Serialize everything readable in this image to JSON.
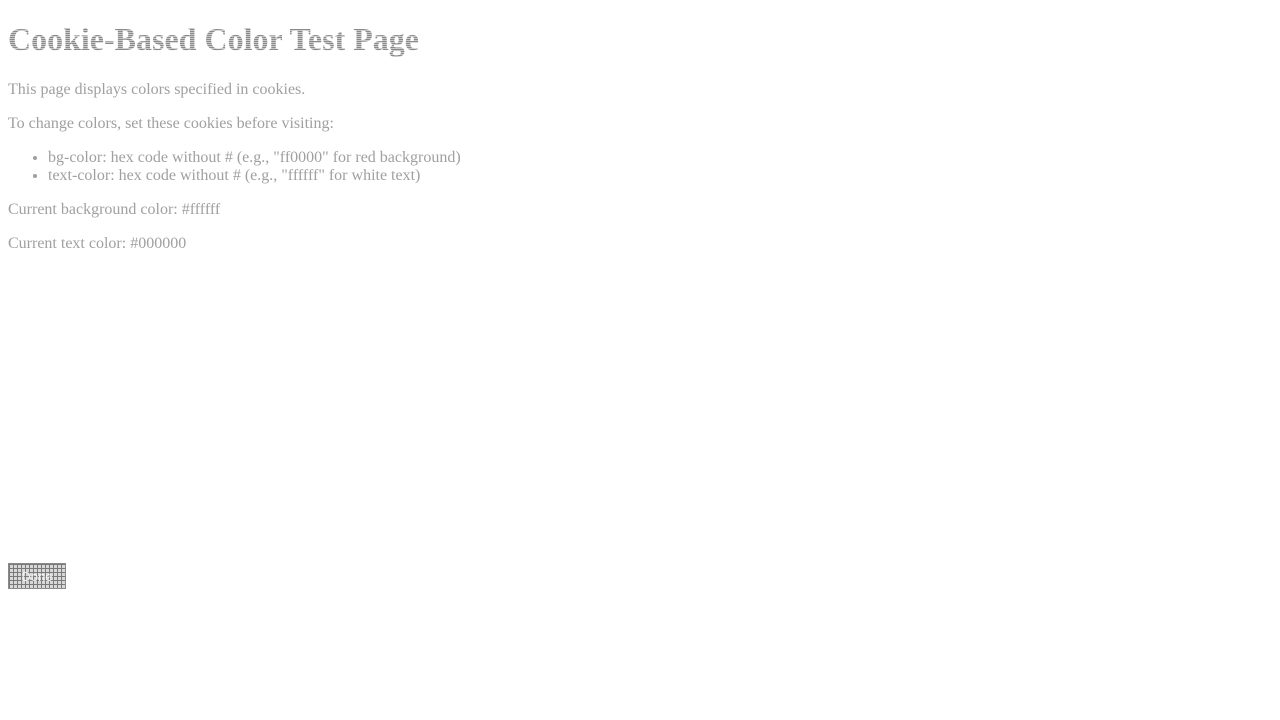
{
  "page": {
    "title": "Cookie-Based Color Test Page",
    "intro": "This page displays colors specified in cookies.",
    "instructions": "To change colors, set these cookies before visiting:",
    "cookies": [
      "bg-color: hex code without # (e.g., \"ff0000\" for red background)",
      "text-color: hex code without # (e.g., \"ffffff\" for white text)"
    ],
    "current_bg": "Current background color: #ffffff",
    "current_text": "Current text color: #000000"
  },
  "button": {
    "label": "Done"
  },
  "colors": {
    "background": "#ffffff",
    "text": "#000000"
  }
}
